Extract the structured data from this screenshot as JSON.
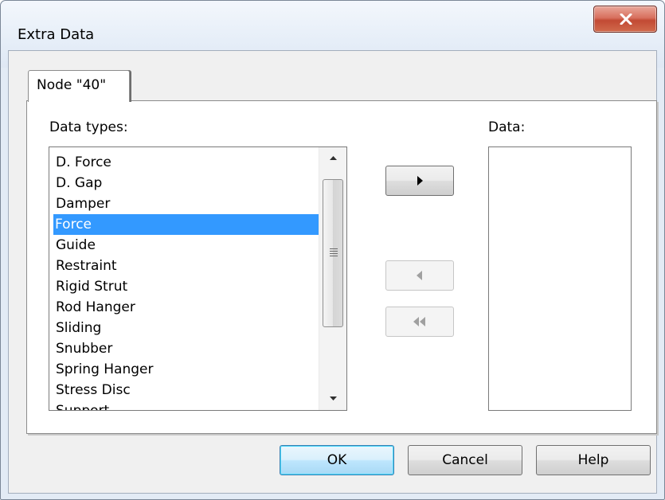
{
  "window": {
    "title": "Extra Data"
  },
  "tabs": [
    {
      "label": "Node \"40\"",
      "selected": true
    }
  ],
  "data_types": {
    "label": "Data types:",
    "items": [
      "D. Force",
      "D. Gap",
      "Damper",
      "Force",
      "Guide",
      "Restraint",
      "Rigid Strut",
      "Rod Hanger",
      "Sliding",
      "Snubber",
      "Spring Hanger",
      "Stress Disc",
      "Support"
    ],
    "selected": "Force"
  },
  "data": {
    "label": "Data:",
    "items": []
  },
  "move_buttons": {
    "add": {
      "icon": "triangle-right-icon",
      "enabled": true
    },
    "remove": {
      "icon": "triangle-left-icon",
      "enabled": false
    },
    "remove_all": {
      "icon": "double-triangle-left-icon",
      "enabled": false
    }
  },
  "buttons": {
    "ok": "OK",
    "cancel": "Cancel",
    "help": "Help"
  },
  "colors": {
    "selection": "#3399ff",
    "close_button": "#c24a34"
  }
}
